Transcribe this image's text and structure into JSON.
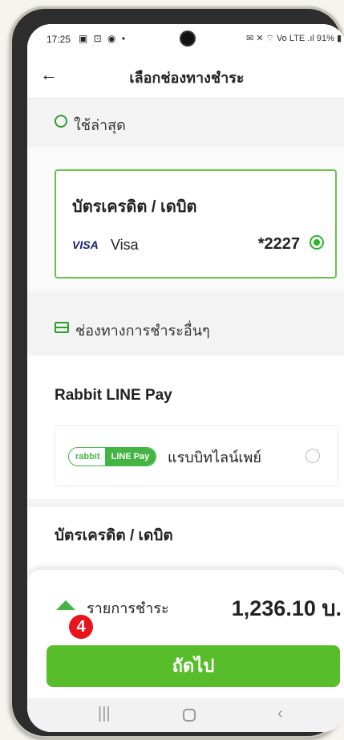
{
  "status_bar": {
    "time": "17:25",
    "left_icons": "▣ ⊡ ◉ •",
    "right_indicators": "✉ ✕ ⌔ Vo LTE .ıl 91% ▮"
  },
  "header": {
    "back_icon": "←",
    "title": "เลือกช่องทางชำระ"
  },
  "recent": {
    "label": "ใช้ล่าสุด",
    "card": {
      "title": "บัตรเครดิต / เดบิต",
      "brand": "VISA",
      "name": "Visa",
      "number": "*2227",
      "selected": true
    }
  },
  "other": {
    "label": "ช่องทางการชำระอื่นๆ",
    "rabbit": {
      "title": "Rabbit LINE Pay",
      "logo_left": "rabbit",
      "logo_right": "LINE Pay",
      "name": "แรบบิทไลน์เพย์",
      "selected": false
    },
    "credit_title": "บัตรเครดิต / เดบิต"
  },
  "summary": {
    "label": "รายการชำระ",
    "amount": "1,236.10 บ.",
    "badge": "4"
  },
  "next_button": "ถัดไป",
  "nav": {
    "recent_icon": "|||",
    "back_icon": "‹"
  },
  "colors": {
    "accent": "#58bd2a",
    "badge": "#e8141c"
  }
}
